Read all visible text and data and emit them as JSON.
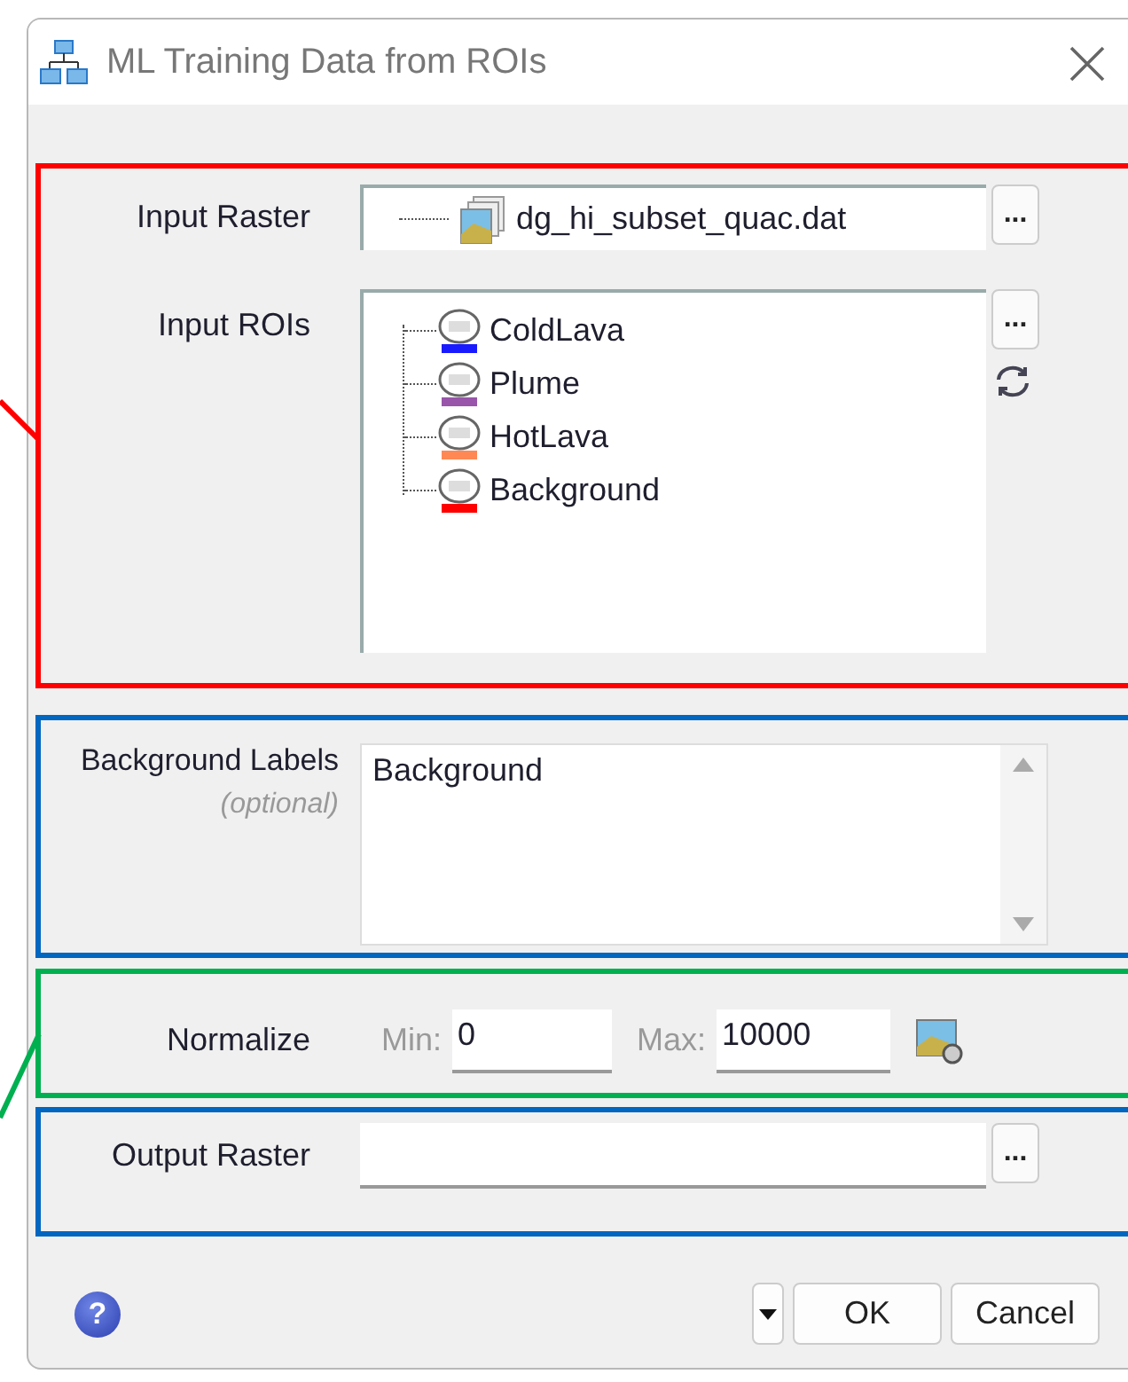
{
  "window": {
    "title": "ML Training Data from ROIs"
  },
  "highlights": [
    {
      "color": "#ff0000"
    },
    {
      "color": "#0066c0"
    },
    {
      "color": "#00b050"
    },
    {
      "color": "#0066c0"
    }
  ],
  "input_raster": {
    "label": "Input Raster",
    "value": "dg_hi_subset_quac.dat",
    "browse": "..."
  },
  "input_rois": {
    "label": "Input ROIs",
    "browse": "...",
    "items": [
      {
        "name": "ColdLava",
        "color": "#1a1aff"
      },
      {
        "name": "Plume",
        "color": "#9955aa"
      },
      {
        "name": "HotLava",
        "color": "#ff8855"
      },
      {
        "name": "Background",
        "color": "#ff0000"
      }
    ]
  },
  "background_labels": {
    "label": "Background Labels",
    "hint": "(optional)",
    "value": "Background"
  },
  "normalize": {
    "label": "Normalize",
    "min_label": "Min:",
    "min": "0",
    "max_label": "Max:",
    "max": "10000"
  },
  "output_raster": {
    "label": "Output Raster",
    "browse": "..."
  },
  "footer": {
    "help": "?",
    "buttons": [
      "OK",
      "Cancel"
    ]
  }
}
